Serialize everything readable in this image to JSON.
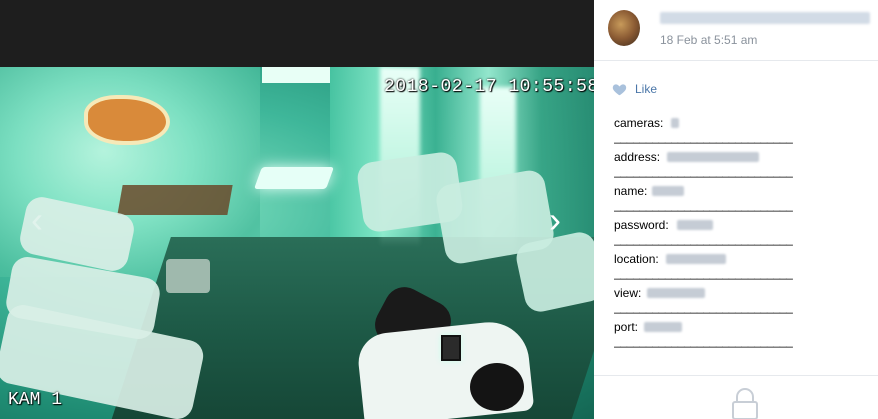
{
  "media": {
    "timestamp": "2018-02-17 10:55:58",
    "camera_label": "KAM 1",
    "nav_prev": "‹",
    "nav_next": "›"
  },
  "post": {
    "date": "18 Feb at 5:51 am",
    "like_label": "Like",
    "accent_color": "#4a76a8"
  },
  "fields": [
    {
      "label": "cameras:",
      "separator": "____________________________"
    },
    {
      "label": "address:",
      "separator": "____________________________"
    },
    {
      "label": "name:",
      "separator": "____________________________"
    },
    {
      "label": "password:",
      "separator": "____________________________"
    },
    {
      "label": "location:",
      "separator": "____________________________"
    },
    {
      "label": "view:",
      "separator": "____________________________"
    },
    {
      "label": "port:",
      "separator": "____________________________"
    }
  ],
  "icons": {
    "like": "heart-icon",
    "lock": "lock-icon"
  }
}
